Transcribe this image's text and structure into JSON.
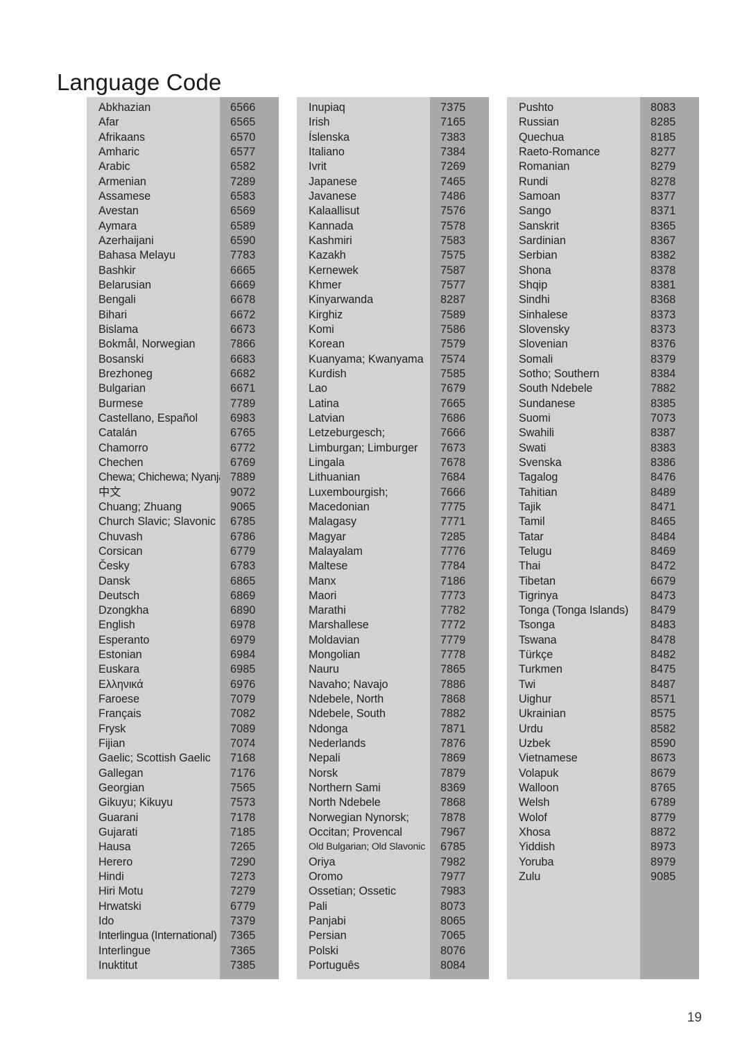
{
  "page": {
    "title": "Language Code",
    "page_number": "19"
  },
  "columns": [
    {
      "id": "column-1",
      "rows": [
        {
          "name": "Abkhazian",
          "code": "6566"
        },
        {
          "name": "Afar",
          "code": "6565"
        },
        {
          "name": "Afrikaans",
          "code": "6570"
        },
        {
          "name": "Amharic",
          "code": "6577"
        },
        {
          "name": "Arabic",
          "code": "6582"
        },
        {
          "name": "Armenian",
          "code": "7289"
        },
        {
          "name": "Assamese",
          "code": "6583"
        },
        {
          "name": "Avestan",
          "code": "6569"
        },
        {
          "name": "Aymara",
          "code": "6589"
        },
        {
          "name": "Azerhaijani",
          "code": "6590"
        },
        {
          "name": "Bahasa Melayu",
          "code": "7783"
        },
        {
          "name": "Bashkir",
          "code": "6665"
        },
        {
          "name": "Belarusian",
          "code": "6669"
        },
        {
          "name": "Bengali",
          "code": "6678"
        },
        {
          "name": "Bihari",
          "code": "6672"
        },
        {
          "name": "Bislama",
          "code": "6673"
        },
        {
          "name": "Bokmål, Norwegian",
          "code": "7866"
        },
        {
          "name": "Bosanski",
          "code": "6683"
        },
        {
          "name": "Brezhoneg",
          "code": "6682"
        },
        {
          "name": "Bulgarian",
          "code": "6671"
        },
        {
          "name": "Burmese",
          "code": "7789"
        },
        {
          "name": "Castellano, Español",
          "code": "6983"
        },
        {
          "name": "Catalán",
          "code": "6765"
        },
        {
          "name": "Chamorro",
          "code": "6772"
        },
        {
          "name": "Chechen",
          "code": "6769"
        },
        {
          "name": "Chewa; Chichewa; Nyanja",
          "code": "7889",
          "style": "overflow"
        },
        {
          "name": "中文",
          "code": "9072"
        },
        {
          "name": "Chuang; Zhuang",
          "code": "9065"
        },
        {
          "name": "Church Slavic; Slavonic",
          "code": "6785"
        },
        {
          "name": "Chuvash",
          "code": "6786"
        },
        {
          "name": "Corsican",
          "code": "6779"
        },
        {
          "name": "Česky",
          "code": "6783"
        },
        {
          "name": "Dansk",
          "code": "6865"
        },
        {
          "name": "Deutsch",
          "code": "6869"
        },
        {
          "name": "Dzongkha",
          "code": "6890"
        },
        {
          "name": "English",
          "code": "6978"
        },
        {
          "name": "Esperanto",
          "code": "6979"
        },
        {
          "name": "Estonian",
          "code": "6984"
        },
        {
          "name": "Euskara",
          "code": "6985"
        },
        {
          "name": "Ελληνικά",
          "code": "6976"
        },
        {
          "name": "Faroese",
          "code": "7079"
        },
        {
          "name": "Français",
          "code": "7082"
        },
        {
          "name": "Frysk",
          "code": "7089"
        },
        {
          "name": "Fijian",
          "code": "7074"
        },
        {
          "name": "Gaelic; Scottish Gaelic",
          "code": "7168"
        },
        {
          "name": "Gallegan",
          "code": "7176"
        },
        {
          "name": "Georgian",
          "code": "7565"
        },
        {
          "name": "Gikuyu; Kikuyu",
          "code": "7573"
        },
        {
          "name": "Guarani",
          "code": "7178"
        },
        {
          "name": "Gujarati",
          "code": "7185"
        },
        {
          "name": "Hausa",
          "code": "7265"
        },
        {
          "name": "Herero",
          "code": "7290"
        },
        {
          "name": "Hindi",
          "code": "7273"
        },
        {
          "name": "Hiri Motu",
          "code": "7279"
        },
        {
          "name": "Hrwatski",
          "code": "6779"
        },
        {
          "name": "Ido",
          "code": "7379"
        },
        {
          "name": "Interlingua (International)",
          "code": "7365",
          "style": "overflow"
        },
        {
          "name": "Interlingue",
          "code": "7365"
        },
        {
          "name": "Inuktitut",
          "code": "7385"
        }
      ]
    },
    {
      "id": "column-2",
      "rows": [
        {
          "name": "Inupiaq",
          "code": "7375"
        },
        {
          "name": "Irish",
          "code": "7165"
        },
        {
          "name": "Íslenska",
          "code": "7383"
        },
        {
          "name": "Italiano",
          "code": "7384"
        },
        {
          "name": "Ivrit",
          "code": "7269"
        },
        {
          "name": "Japanese",
          "code": "7465"
        },
        {
          "name": "Javanese",
          "code": "7486"
        },
        {
          "name": "Kalaallisut",
          "code": "7576"
        },
        {
          "name": "Kannada",
          "code": "7578"
        },
        {
          "name": "Kashmiri",
          "code": "7583"
        },
        {
          "name": "Kazakh",
          "code": "7575"
        },
        {
          "name": "Kernewek",
          "code": "7587"
        },
        {
          "name": "Khmer",
          "code": "7577"
        },
        {
          "name": "Kinyarwanda",
          "code": "8287"
        },
        {
          "name": "Kirghiz",
          "code": "7589"
        },
        {
          "name": "Komi",
          "code": "7586"
        },
        {
          "name": "Korean",
          "code": "7579"
        },
        {
          "name": "Kuanyama; Kwanyama",
          "code": "7574"
        },
        {
          "name": "Kurdish",
          "code": "7585"
        },
        {
          "name": "Lao",
          "code": "7679"
        },
        {
          "name": "Latina",
          "code": "7665"
        },
        {
          "name": "Latvian",
          "code": "7686"
        },
        {
          "name": "Letzeburgesch;",
          "code": "7666"
        },
        {
          "name": "Limburgan; Limburger",
          "code": "7673"
        },
        {
          "name": "Lingala",
          "code": "7678"
        },
        {
          "name": "Lithuanian",
          "code": "7684"
        },
        {
          "name": "Luxembourgish;",
          "code": "7666"
        },
        {
          "name": "Macedonian",
          "code": "7775"
        },
        {
          "name": "Malagasy",
          "code": "7771"
        },
        {
          "name": "Magyar",
          "code": "7285"
        },
        {
          "name": "Malayalam",
          "code": "7776"
        },
        {
          "name": "Maltese",
          "code": "7784"
        },
        {
          "name": "Manx",
          "code": "7186"
        },
        {
          "name": "Maori",
          "code": "7773"
        },
        {
          "name": "Marathi",
          "code": "7782"
        },
        {
          "name": "Marshallese",
          "code": "7772"
        },
        {
          "name": "Moldavian",
          "code": "7779"
        },
        {
          "name": "Mongolian",
          "code": "7778"
        },
        {
          "name": "Nauru",
          "code": "7865"
        },
        {
          "name": "Navaho; Navajo",
          "code": "7886"
        },
        {
          "name": "Ndebele, North",
          "code": "7868"
        },
        {
          "name": "Ndebele, South",
          "code": "7882"
        },
        {
          "name": "Ndonga",
          "code": "7871"
        },
        {
          "name": "Nederlands",
          "code": "7876"
        },
        {
          "name": "Nepali",
          "code": "7869"
        },
        {
          "name": "Norsk",
          "code": "7879"
        },
        {
          "name": "Northern Sami",
          "code": "8369"
        },
        {
          "name": "North Ndebele",
          "code": "7868"
        },
        {
          "name": "Norwegian Nynorsk;",
          "code": "7878"
        },
        {
          "name": "Occitan; Provencal",
          "code": "7967"
        },
        {
          "name": "Old Bulgarian; Old Slavonic",
          "code": "6785",
          "style": "squeeze"
        },
        {
          "name": "Oriya",
          "code": "7982"
        },
        {
          "name": "Oromo",
          "code": "7977"
        },
        {
          "name": "Ossetian; Ossetic",
          "code": "7983"
        },
        {
          "name": "Pali",
          "code": "8073"
        },
        {
          "name": "Panjabi",
          "code": "8065"
        },
        {
          "name": "Persian",
          "code": "7065"
        },
        {
          "name": "Polski",
          "code": "8076"
        },
        {
          "name": "Português",
          "code": "8084"
        }
      ]
    },
    {
      "id": "column-3",
      "rows": [
        {
          "name": "Pushto",
          "code": "8083"
        },
        {
          "name": "Russian",
          "code": "8285"
        },
        {
          "name": "Quechua",
          "code": "8185"
        },
        {
          "name": "Raeto-Romance",
          "code": "8277"
        },
        {
          "name": "Romanian",
          "code": "8279"
        },
        {
          "name": "Rundi",
          "code": "8278"
        },
        {
          "name": "Samoan",
          "code": "8377"
        },
        {
          "name": "Sango",
          "code": "8371"
        },
        {
          "name": "Sanskrit",
          "code": "8365"
        },
        {
          "name": "Sardinian",
          "code": "8367"
        },
        {
          "name": "Serbian",
          "code": "8382"
        },
        {
          "name": "Shona",
          "code": "8378"
        },
        {
          "name": "Shqip",
          "code": "8381"
        },
        {
          "name": "Sindhi",
          "code": "8368"
        },
        {
          "name": "Sinhalese",
          "code": "8373"
        },
        {
          "name": "Slovensky",
          "code": "8373"
        },
        {
          "name": "Slovenian",
          "code": "8376"
        },
        {
          "name": "Somali",
          "code": "8379"
        },
        {
          "name": "Sotho; Southern",
          "code": "8384"
        },
        {
          "name": "South Ndebele",
          "code": "7882"
        },
        {
          "name": "Sundanese",
          "code": "8385"
        },
        {
          "name": "Suomi",
          "code": "7073"
        },
        {
          "name": "Swahili",
          "code": "8387"
        },
        {
          "name": "Swati",
          "code": "8383"
        },
        {
          "name": "Svenska",
          "code": "8386"
        },
        {
          "name": "Tagalog",
          "code": "8476"
        },
        {
          "name": "Tahitian",
          "code": "8489"
        },
        {
          "name": "Tajik",
          "code": "8471"
        },
        {
          "name": "Tamil",
          "code": "8465"
        },
        {
          "name": "Tatar",
          "code": "8484"
        },
        {
          "name": "Telugu",
          "code": "8469"
        },
        {
          "name": "Thai",
          "code": "8472"
        },
        {
          "name": "Tibetan",
          "code": "6679"
        },
        {
          "name": "Tigrinya",
          "code": "8473"
        },
        {
          "name": "Tonga (Tonga Islands)",
          "code": "8479"
        },
        {
          "name": "Tsonga",
          "code": "8483"
        },
        {
          "name": "Tswana",
          "code": "8478"
        },
        {
          "name": "Türkçe",
          "code": "8482"
        },
        {
          "name": "Turkmen",
          "code": "8475"
        },
        {
          "name": "Twi",
          "code": "8487"
        },
        {
          "name": "Uighur",
          "code": "8571"
        },
        {
          "name": "Ukrainian",
          "code": "8575"
        },
        {
          "name": "Urdu",
          "code": "8582"
        },
        {
          "name": "Uzbek",
          "code": "8590"
        },
        {
          "name": "Vietnamese",
          "code": "8673"
        },
        {
          "name": "Volapuk",
          "code": "8679"
        },
        {
          "name": "Walloon",
          "code": "8765"
        },
        {
          "name": "Welsh",
          "code": "6789"
        },
        {
          "name": "Wolof",
          "code": "8779"
        },
        {
          "name": "Xhosa",
          "code": "8872"
        },
        {
          "name": "Yiddish",
          "code": "8973"
        },
        {
          "name": "Yoruba",
          "code": "8979"
        },
        {
          "name": "Zulu",
          "code": "9085"
        }
      ]
    }
  ]
}
